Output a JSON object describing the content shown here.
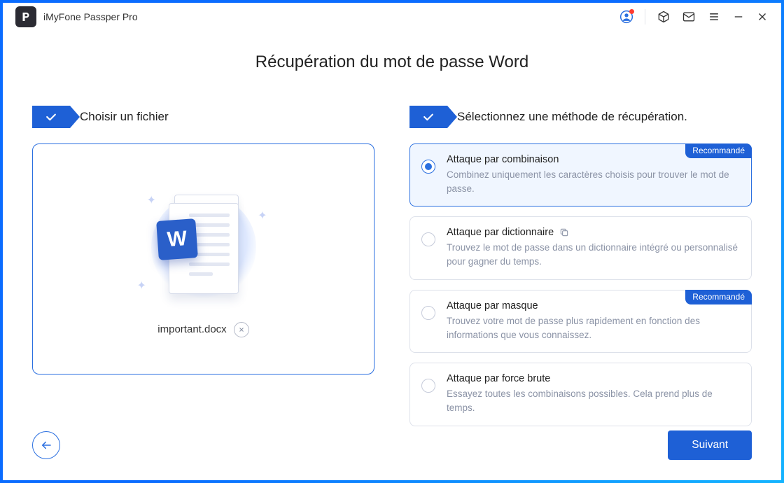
{
  "app": {
    "title": "iMyFone Passper Pro"
  },
  "page": {
    "title": "Récupération du mot de passe Word"
  },
  "steps": {
    "choose_file": "Choisir un fichier",
    "choose_method": "Sélectionnez une méthode de récupération."
  },
  "file": {
    "name": "important.docx",
    "word_letter": "W"
  },
  "recommended_label": "Recommandé",
  "methods": [
    {
      "title": "Attaque par combinaison",
      "desc": "Combinez uniquement les caractères choisis pour trouver le mot de passe.",
      "recommended": true,
      "selected": true
    },
    {
      "title": "Attaque par dictionnaire",
      "desc": "Trouvez le mot de passe dans un dictionnaire intégré ou personnalisé pour gagner du temps.",
      "has_copy_icon": true
    },
    {
      "title": "Attaque par masque",
      "desc": "Trouvez votre mot de passe plus rapidement en fonction des informations que vous connaissez.",
      "recommended": true
    },
    {
      "title": "Attaque par force brute",
      "desc": "Essayez toutes les combinaisons possibles. Cela prend plus de temps."
    }
  ],
  "footer": {
    "next": "Suivant"
  }
}
